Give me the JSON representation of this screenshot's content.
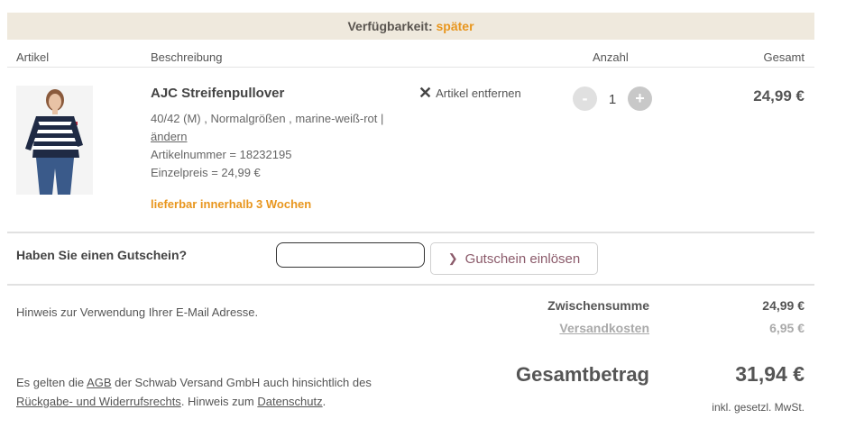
{
  "availability": {
    "label": "Verfügbarkeit:",
    "value": "später"
  },
  "table_headers": {
    "article": "Artikel",
    "description": "Beschreibung",
    "quantity": "Anzahl",
    "total": "Gesamt"
  },
  "item": {
    "name": "AJC Streifenpullover",
    "variant": "40/42 (M) , Normalgrößen , marine-weiß-rot |",
    "change_link": "ändern",
    "article_number": "Artikelnummer = 18232195",
    "unit_price": "Einzelpreis = 24,99 €",
    "delivery": "lieferbar innerhalb 3 Wochen",
    "remove_label": "Artikel entfernen",
    "quantity": "1",
    "minus": "-",
    "plus": "+",
    "total": "24,99 €"
  },
  "voucher": {
    "question": "Haben Sie einen Gutschein?",
    "input_value": "",
    "button_label": "Gutschein einlösen"
  },
  "email_hint": "Hinweis zur Verwendung Ihrer E-Mail Adresse.",
  "summary": {
    "subtotal_label": "Zwischensumme",
    "subtotal_value": "24,99 €",
    "shipping_label": "Versandkosten",
    "shipping_value": "6,95 €",
    "total_label": "Gesamtbetrag",
    "total_value": "31,94 €",
    "vat_note": "inkl. gesetzl. MwSt."
  },
  "terms": {
    "p1": "Es gelten die ",
    "agb": "AGB",
    "p2": " der Schwab Versand GmbH auch hinsichtlich des",
    "return_link": "Rückgabe- und Widerrufsrechts",
    "p3": ". Hinweis zum ",
    "privacy_link": "Datenschutz",
    "p4": "."
  },
  "colors": {
    "accent_orange": "#e8961e",
    "banner_bg": "#efe9dd",
    "button_text": "#8b5a6a"
  }
}
